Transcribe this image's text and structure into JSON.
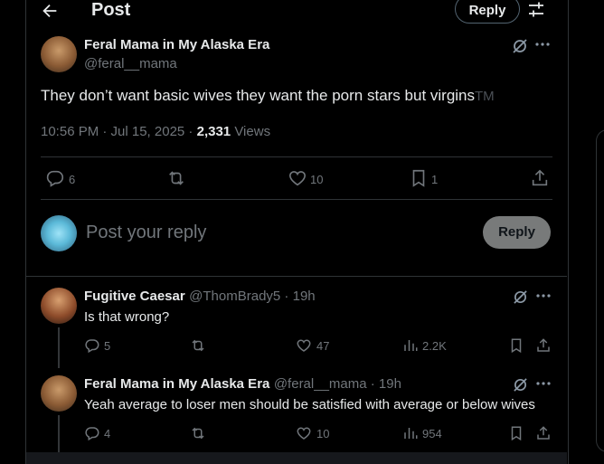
{
  "header": {
    "title": "Post",
    "reply_button": "Reply"
  },
  "main_post": {
    "author_name": "Feral Mama in My Alaska Era",
    "author_handle": "@feral__mama",
    "text": "They don’t want basic wives they want the porn stars but virgins",
    "text_suffix": "TM",
    "time": "10:56 PM · Jul 15, 2025 · ",
    "views_count": "2,331",
    "views_label": " Views",
    "replies": "6",
    "likes": "10",
    "bookmarks": "1"
  },
  "composer": {
    "placeholder": "Post your reply",
    "reply_button": "Reply"
  },
  "replies": [
    {
      "author_name": "Fugitive Caesar",
      "meta": "@ThomBrady5 · 19h",
      "text": "Is that wrong?",
      "replies": "5",
      "likes": "47",
      "views": "2.2K"
    },
    {
      "author_name": "Feral Mama in My Alaska Era",
      "meta": "@feral__mama · 19h",
      "text": "Yeah average to loser men should be satisfied with average or below wives",
      "replies": "4",
      "likes": "10",
      "views": "954"
    }
  ],
  "colors": {
    "background": "#000000",
    "text": "#e7e9ea",
    "secondary": "#71767b",
    "border": "#2f3336"
  }
}
